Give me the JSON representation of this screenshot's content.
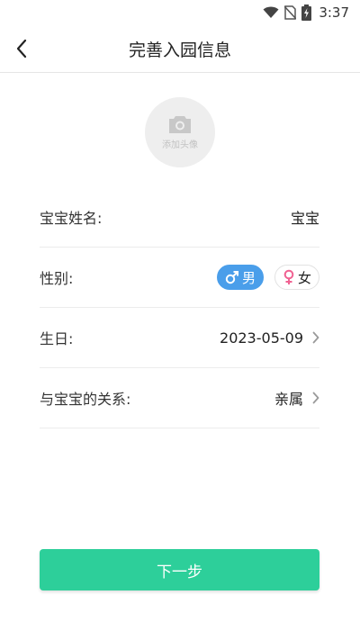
{
  "status_bar": {
    "time": "3:37",
    "icons": [
      "wifi-icon",
      "no-sim-icon",
      "battery-charging-icon"
    ]
  },
  "header": {
    "title": "完善入园信息",
    "back_icon": "chevron-left-icon"
  },
  "avatar": {
    "label": "添加头像",
    "icon": "camera-icon"
  },
  "form": {
    "name": {
      "label": "宝宝姓名:",
      "value": "宝宝"
    },
    "gender": {
      "label": "性别:",
      "male_label": "男",
      "female_label": "女",
      "selected": "男"
    },
    "birthday": {
      "label": "生日:",
      "value": "2023-05-09"
    },
    "relation": {
      "label": "与宝宝的关系:",
      "value": "亲属"
    }
  },
  "actions": {
    "next_label": "下一步"
  },
  "colors": {
    "accent_green": "#2dcf9a",
    "male_blue": "#4a9eea",
    "female_pink": "#f06292"
  }
}
